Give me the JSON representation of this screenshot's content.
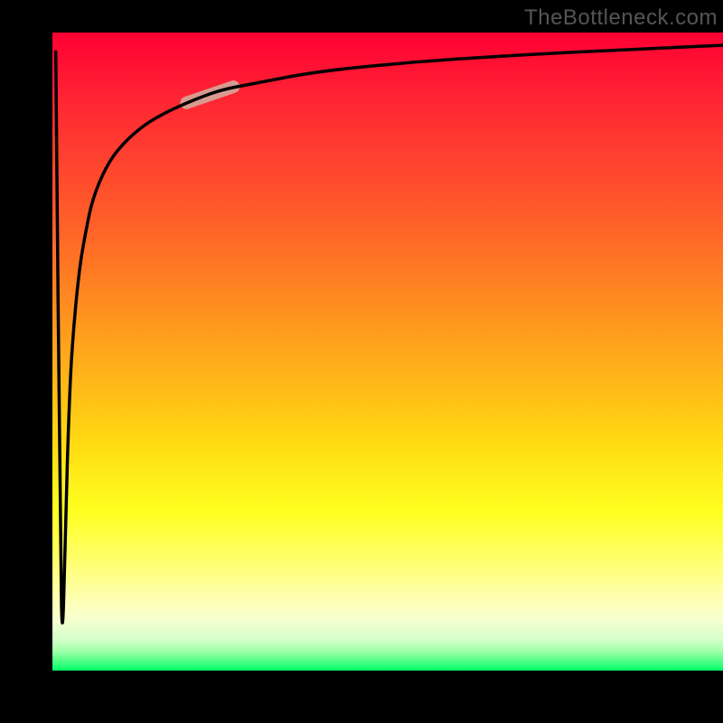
{
  "attribution": "TheBottleneck.com",
  "colors": {
    "frame": "#000000",
    "curve": "#000000",
    "highlight": "#d99a8f"
  },
  "chart_data": {
    "type": "line",
    "title": "",
    "xlabel": "",
    "ylabel": "",
    "xlim": [
      0,
      100
    ],
    "ylim": [
      0,
      100
    ],
    "x": [
      0.5,
      1.2,
      1.5,
      2.0,
      2.5,
      3.0,
      4.0,
      5.0,
      6.0,
      8.0,
      10,
      13,
      16,
      20,
      25,
      30,
      40,
      55,
      70,
      85,
      100
    ],
    "values": [
      97,
      18,
      3,
      25,
      42,
      52,
      63,
      69,
      74,
      79,
      82,
      85,
      87,
      89,
      91,
      92,
      94,
      95.5,
      96.5,
      97.3,
      98
    ],
    "highlight_segment": {
      "x_start": 20,
      "x_end": 27,
      "y_start": 89,
      "y_end": 91.5
    },
    "background_gradient_stops": [
      {
        "pos": 0,
        "color": "#ff0033"
      },
      {
        "pos": 12,
        "color": "#ff2a33"
      },
      {
        "pos": 28,
        "color": "#ff5a2a"
      },
      {
        "pos": 42,
        "color": "#ff8a20"
      },
      {
        "pos": 55,
        "color": "#ffb818"
      },
      {
        "pos": 65,
        "color": "#ffdd12"
      },
      {
        "pos": 75,
        "color": "#ffff20"
      },
      {
        "pos": 82,
        "color": "#ffff66"
      },
      {
        "pos": 88,
        "color": "#ffffaa"
      },
      {
        "pos": 92,
        "color": "#f6ffcf"
      },
      {
        "pos": 95,
        "color": "#d6ffcc"
      },
      {
        "pos": 97,
        "color": "#9effa6"
      },
      {
        "pos": 100,
        "color": "#00ff66"
      }
    ]
  }
}
